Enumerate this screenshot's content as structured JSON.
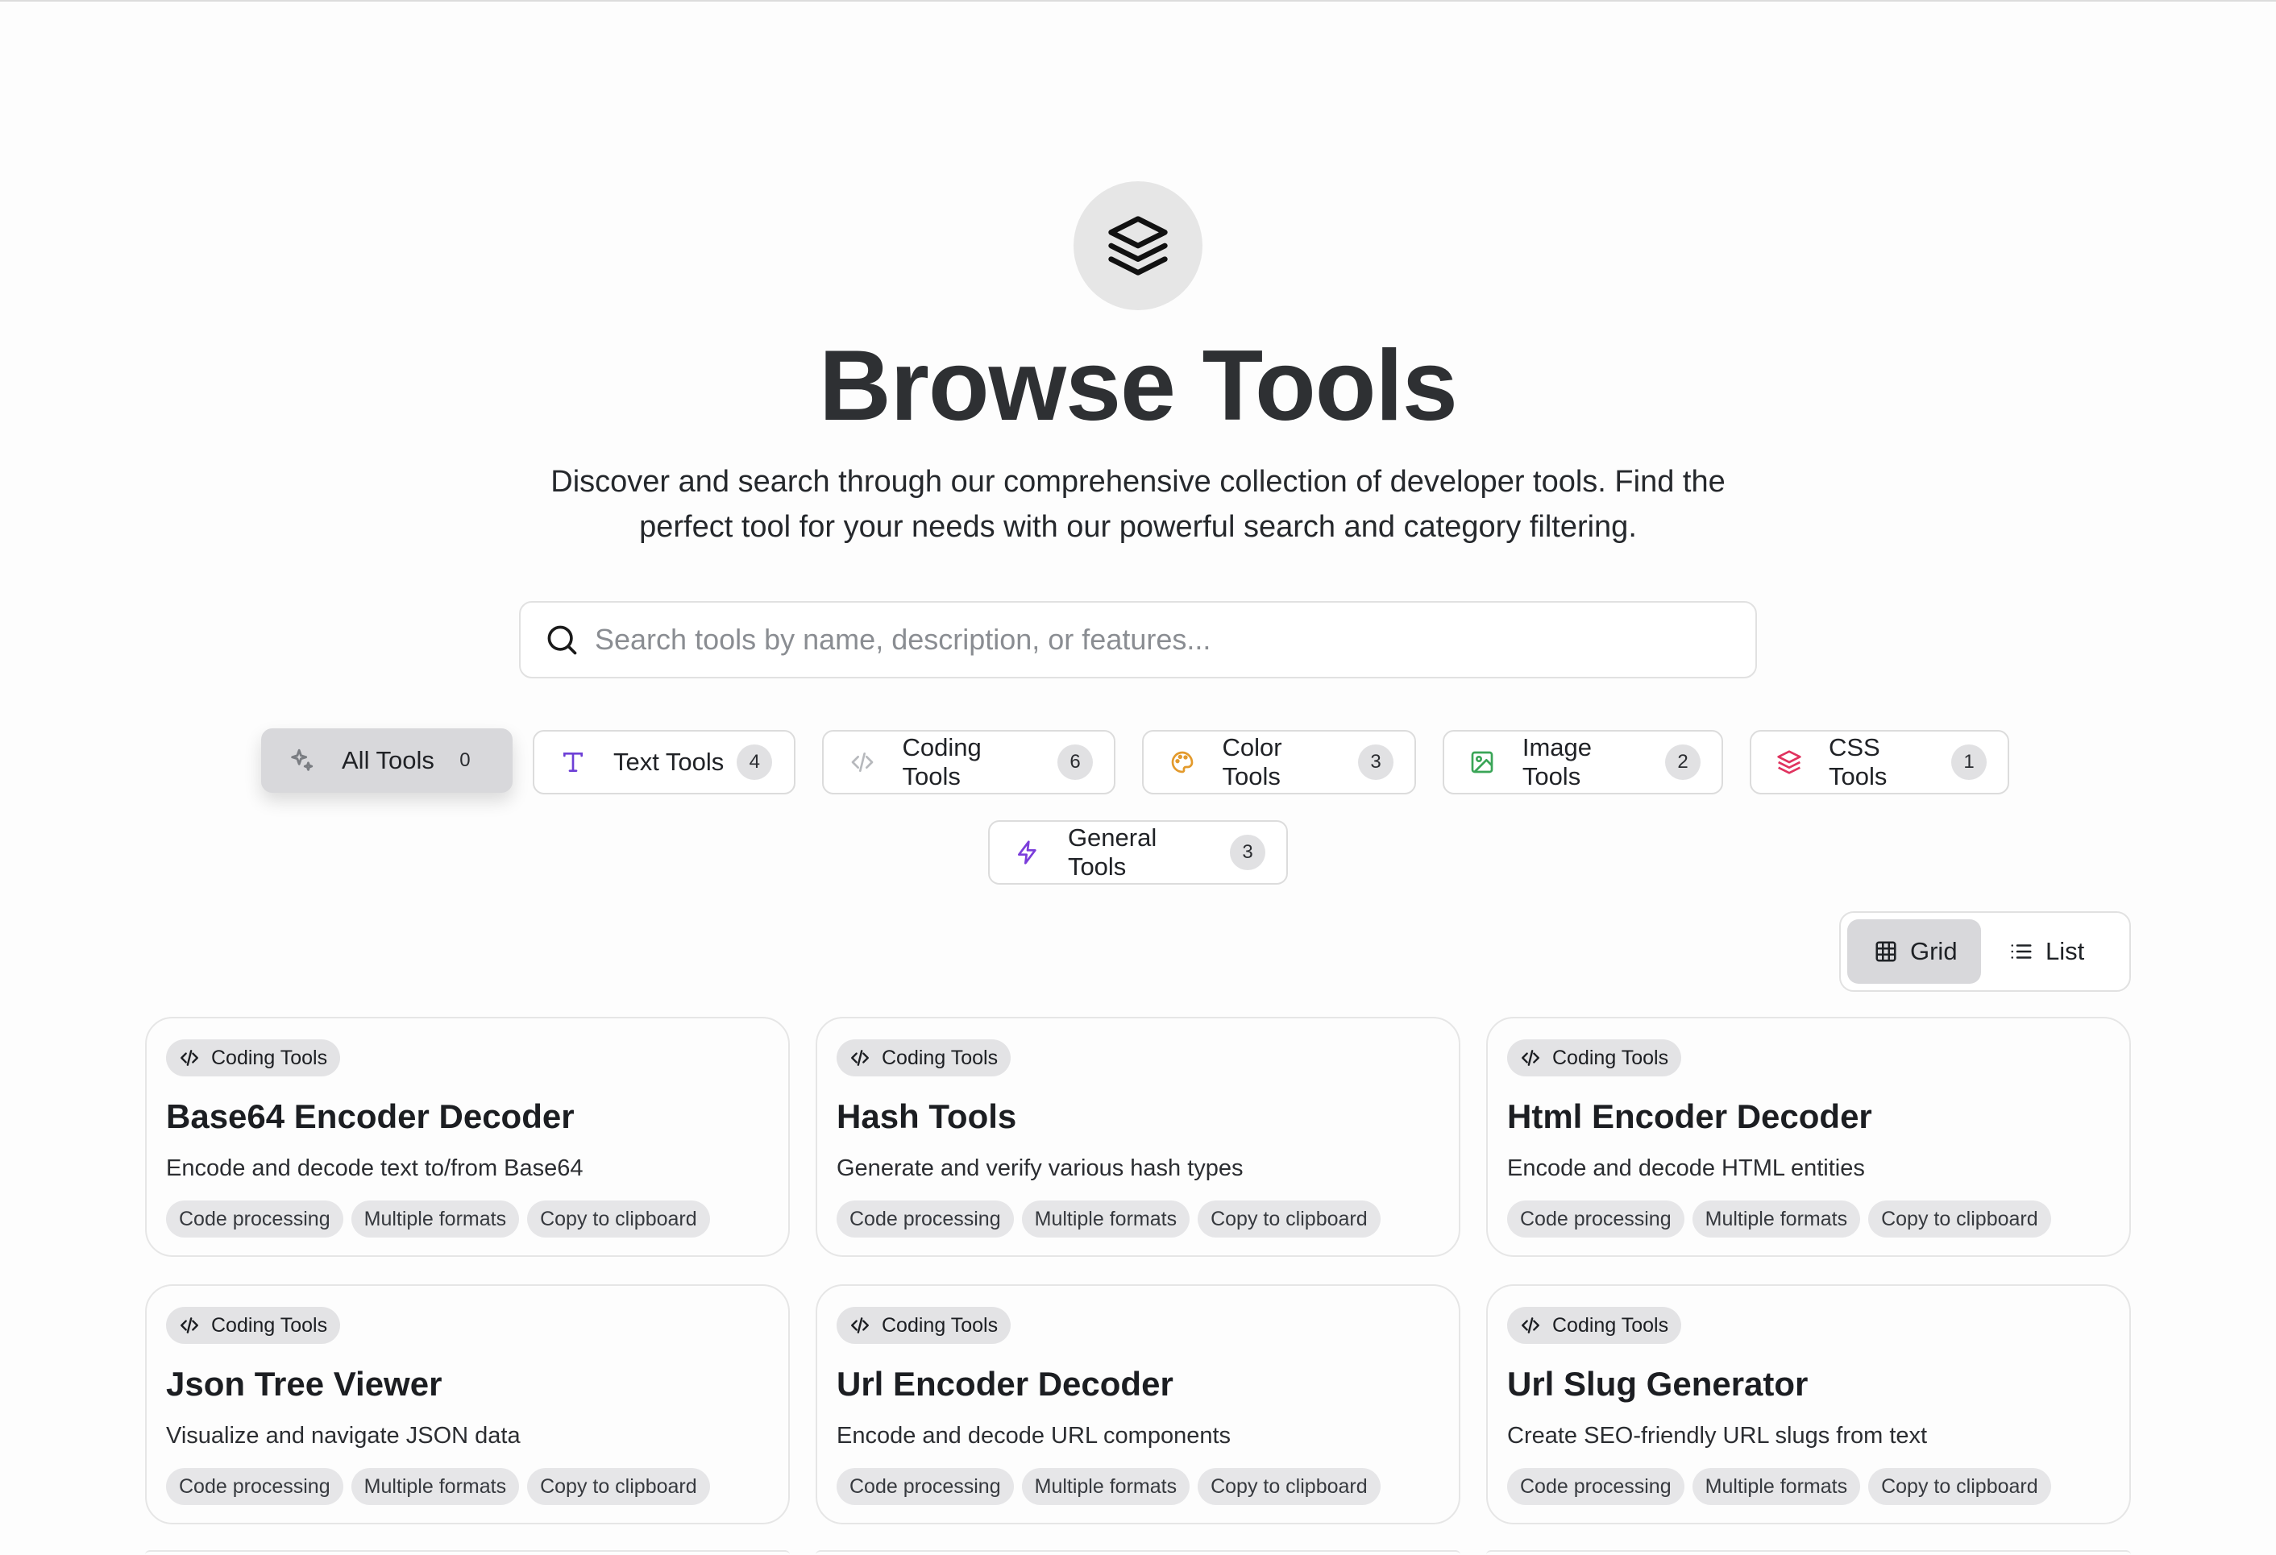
{
  "hero": {
    "icon": "layers-icon",
    "title": "Browse Tools",
    "subtitle": "Discover and search through our comprehensive collection of developer tools. Find the perfect tool for your needs with our powerful search and category filtering."
  },
  "search": {
    "placeholder": "Search tools by name, description, or features...",
    "value": "",
    "icon": "search-icon"
  },
  "categories": [
    {
      "label": "All Tools",
      "count": "0",
      "icon": "sparkles-icon",
      "color": "#7a7d82",
      "active": true
    },
    {
      "label": "Text Tools",
      "count": "4",
      "icon": "type-icon",
      "color": "#6d3fd6"
    },
    {
      "label": "Coding Tools",
      "count": "6",
      "icon": "code-icon",
      "color": "#b7b9bd"
    },
    {
      "label": "Color Tools",
      "count": "3",
      "icon": "palette-icon",
      "color": "#e39a2c"
    },
    {
      "label": "Image Tools",
      "count": "2",
      "icon": "image-icon",
      "color": "#3aa557"
    },
    {
      "label": "CSS Tools",
      "count": "1",
      "icon": "layers-icon",
      "color": "#e0335f"
    },
    {
      "label": "General Tools",
      "count": "3",
      "icon": "zap-icon",
      "color": "#7b3ddb"
    }
  ],
  "view_toggle": {
    "grid_label": "Grid",
    "list_label": "List",
    "selected": "Grid"
  },
  "tools": [
    {
      "category": "Coding Tools",
      "title": "Base64 Encoder Decoder",
      "description": "Encode and decode text to/from Base64",
      "tags": [
        "Code processing",
        "Multiple formats",
        "Copy to clipboard"
      ]
    },
    {
      "category": "Coding Tools",
      "title": "Hash Tools",
      "description": "Generate and verify various hash types",
      "tags": [
        "Code processing",
        "Multiple formats",
        "Copy to clipboard"
      ]
    },
    {
      "category": "Coding Tools",
      "title": "Html Encoder Decoder",
      "description": "Encode and decode HTML entities",
      "tags": [
        "Code processing",
        "Multiple formats",
        "Copy to clipboard"
      ]
    },
    {
      "category": "Coding Tools",
      "title": "Json Tree Viewer",
      "description": "Visualize and navigate JSON data",
      "tags": [
        "Code processing",
        "Multiple formats",
        "Copy to clipboard"
      ]
    },
    {
      "category": "Coding Tools",
      "title": "Url Encoder Decoder",
      "description": "Encode and decode URL components",
      "tags": [
        "Code processing",
        "Multiple formats",
        "Copy to clipboard"
      ]
    },
    {
      "category": "Coding Tools",
      "title": "Url Slug Generator",
      "description": "Create SEO-friendly URL slugs from text",
      "tags": [
        "Code processing",
        "Multiple formats",
        "Copy to clipboard"
      ]
    }
  ]
}
